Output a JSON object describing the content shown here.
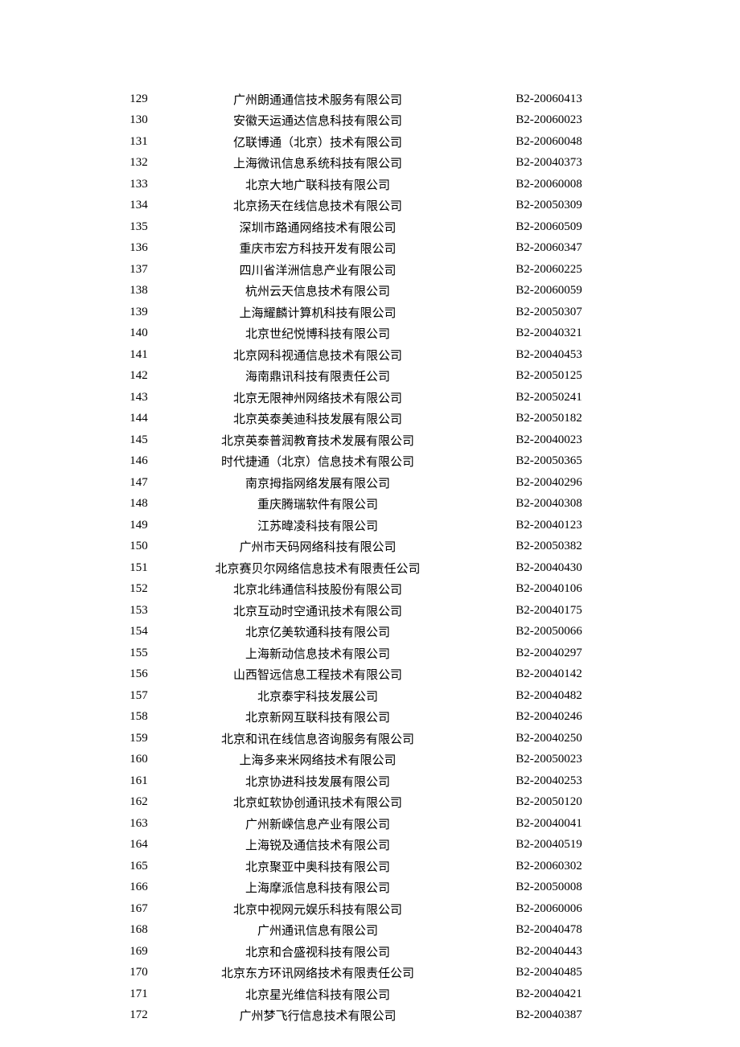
{
  "rows": [
    {
      "num": "129",
      "name": "广州朗通通信技术服务有限公司",
      "code": "B2-20060413"
    },
    {
      "num": "130",
      "name": "安徽天运通达信息科技有限公司",
      "code": "B2-20060023"
    },
    {
      "num": "131",
      "name": "亿联博通（北京）技术有限公司",
      "code": "B2-20060048"
    },
    {
      "num": "132",
      "name": "上海微讯信息系统科技有限公司",
      "code": "B2-20040373"
    },
    {
      "num": "133",
      "name": "北京大地广联科技有限公司",
      "code": "B2-20060008"
    },
    {
      "num": "134",
      "name": "北京扬天在线信息技术有限公司",
      "code": "B2-20050309"
    },
    {
      "num": "135",
      "name": "深圳市路通网络技术有限公司",
      "code": "B2-20060509"
    },
    {
      "num": "136",
      "name": "重庆市宏方科技开发有限公司",
      "code": "B2-20060347"
    },
    {
      "num": "137",
      "name": "四川省洋洲信息产业有限公司",
      "code": "B2-20060225"
    },
    {
      "num": "138",
      "name": "杭州云天信息技术有限公司",
      "code": "B2-20060059"
    },
    {
      "num": "139",
      "name": "上海耀麟计算机科技有限公司",
      "code": "B2-20050307"
    },
    {
      "num": "140",
      "name": "北京世纪悦博科技有限公司",
      "code": "B2-20040321"
    },
    {
      "num": "141",
      "name": "北京网科视通信息技术有限公司",
      "code": "B2-20040453"
    },
    {
      "num": "142",
      "name": "海南鼎讯科技有限责任公司",
      "code": "B2-20050125"
    },
    {
      "num": "143",
      "name": "北京无限神州网络技术有限公司",
      "code": "B2-20050241"
    },
    {
      "num": "144",
      "name": "北京英泰美迪科技发展有限公司",
      "code": "B2-20050182"
    },
    {
      "num": "145",
      "name": "北京英泰普润教育技术发展有限公司",
      "code": "B2-20040023"
    },
    {
      "num": "146",
      "name": "时代捷通（北京）信息技术有限公司",
      "code": "B2-20050365"
    },
    {
      "num": "147",
      "name": "南京拇指网络发展有限公司",
      "code": "B2-20040296"
    },
    {
      "num": "148",
      "name": "重庆腾瑞软件有限公司",
      "code": "B2-20040308"
    },
    {
      "num": "149",
      "name": "江苏暐凌科技有限公司",
      "code": "B2-20040123"
    },
    {
      "num": "150",
      "name": "广州市天码网络科技有限公司",
      "code": "B2-20050382"
    },
    {
      "num": "151",
      "name": "北京赛贝尔网络信息技术有限责任公司",
      "code": "B2-20040430"
    },
    {
      "num": "152",
      "name": "北京北纬通信科技股份有限公司",
      "code": "B2-20040106"
    },
    {
      "num": "153",
      "name": "北京互动时空通讯技术有限公司",
      "code": "B2-20040175"
    },
    {
      "num": "154",
      "name": "北京亿美软通科技有限公司",
      "code": "B2-20050066"
    },
    {
      "num": "155",
      "name": "上海新动信息技术有限公司",
      "code": "B2-20040297"
    },
    {
      "num": "156",
      "name": "山西智远信息工程技术有限公司",
      "code": "B2-20040142"
    },
    {
      "num": "157",
      "name": "北京泰宇科技发展公司",
      "code": "B2-20040482"
    },
    {
      "num": "158",
      "name": "北京新网互联科技有限公司",
      "code": "B2-20040246"
    },
    {
      "num": "159",
      "name": "北京和讯在线信息咨询服务有限公司",
      "code": "B2-20040250"
    },
    {
      "num": "160",
      "name": "上海多来米网络技术有限公司",
      "code": "B2-20050023"
    },
    {
      "num": "161",
      "name": "北京协进科技发展有限公司",
      "code": "B2-20040253"
    },
    {
      "num": "162",
      "name": "北京虹软协创通讯技术有限公司",
      "code": "B2-20050120"
    },
    {
      "num": "163",
      "name": "广州新嵘信息产业有限公司",
      "code": "B2-20040041"
    },
    {
      "num": "164",
      "name": "上海锐及通信技术有限公司",
      "code": "B2-20040519"
    },
    {
      "num": "165",
      "name": "北京聚亚中奥科技有限公司",
      "code": "B2-20060302"
    },
    {
      "num": "166",
      "name": "上海摩派信息科技有限公司",
      "code": "B2-20050008"
    },
    {
      "num": "167",
      "name": "北京中视网元娱乐科技有限公司",
      "code": "B2-20060006"
    },
    {
      "num": "168",
      "name": "广州通讯信息有限公司",
      "code": "B2-20040478"
    },
    {
      "num": "169",
      "name": "北京和合盛视科技有限公司",
      "code": "B2-20040443"
    },
    {
      "num": "170",
      "name": "北京东方环讯网络技术有限责任公司",
      "code": "B2-20040485"
    },
    {
      "num": "171",
      "name": "北京星光维信科技有限公司",
      "code": "B2-20040421"
    },
    {
      "num": "172",
      "name": "广州梦飞行信息技术有限公司",
      "code": "B2-20040387"
    }
  ]
}
